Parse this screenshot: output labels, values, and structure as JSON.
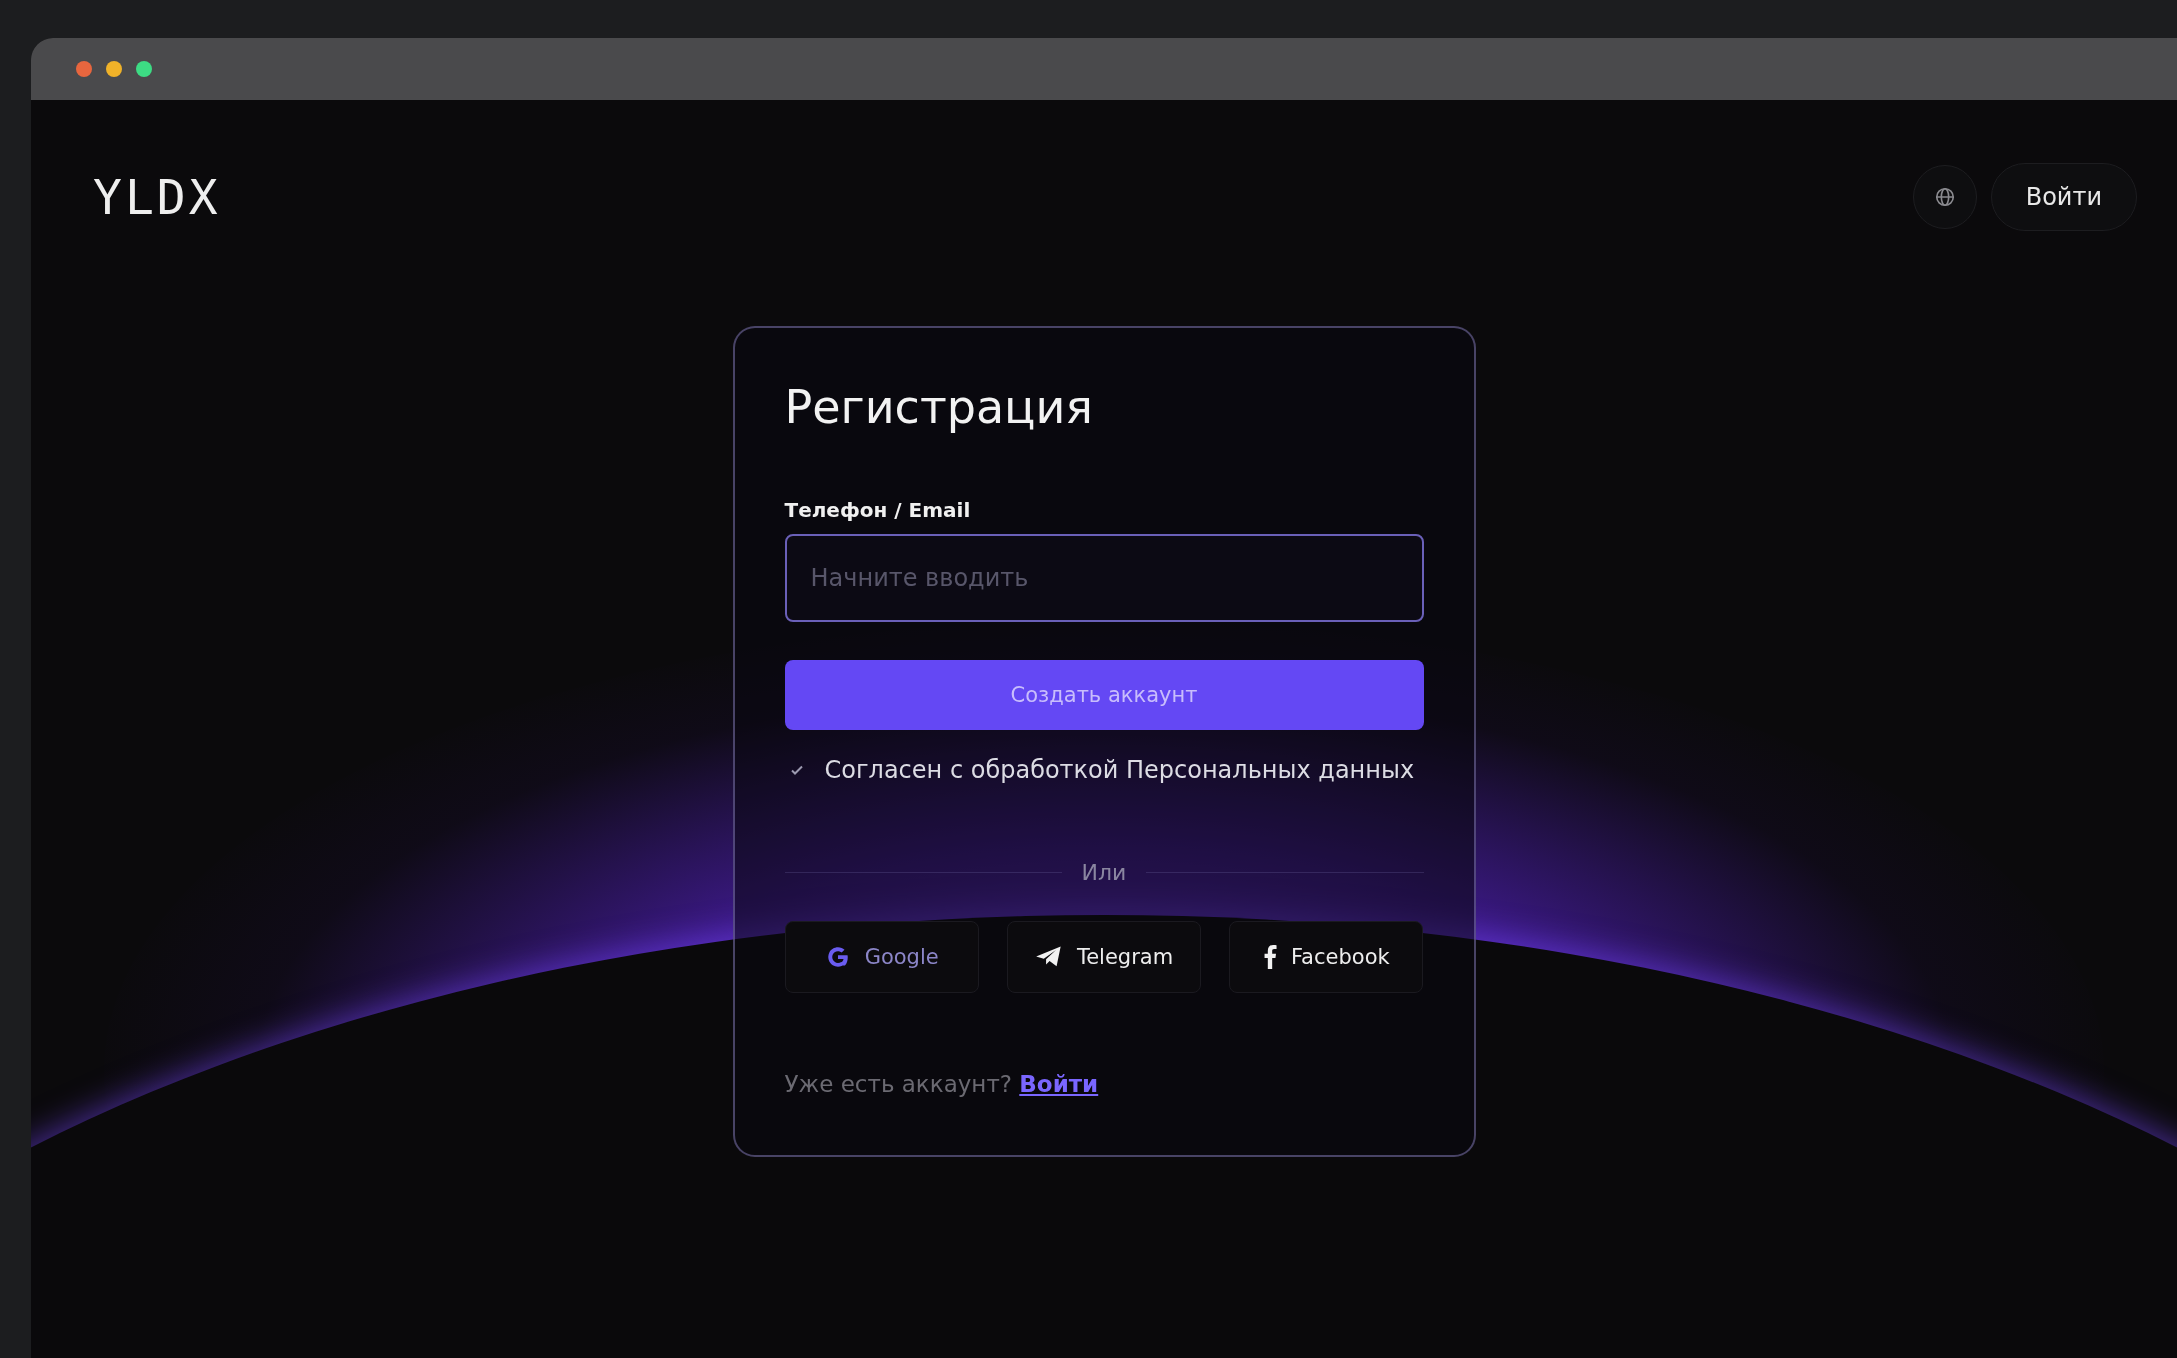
{
  "header": {
    "logo": "YLDX",
    "login_button": "Войти"
  },
  "form": {
    "title": "Регистрация",
    "field": {
      "label": "Телефон / Email",
      "placeholder": "Начните вводить"
    },
    "submit": "Создать аккаунт",
    "consent": {
      "label": "Согласен с обработкой Персональных данных",
      "checked": true
    },
    "divider": "Или",
    "social": [
      {
        "kind": "google",
        "label": "Google"
      },
      {
        "kind": "telegram",
        "label": "Telegram"
      },
      {
        "kind": "facebook",
        "label": "Facebook"
      }
    ],
    "footer": {
      "text": "Уже есть аккаунт?",
      "link": "Войти"
    }
  }
}
